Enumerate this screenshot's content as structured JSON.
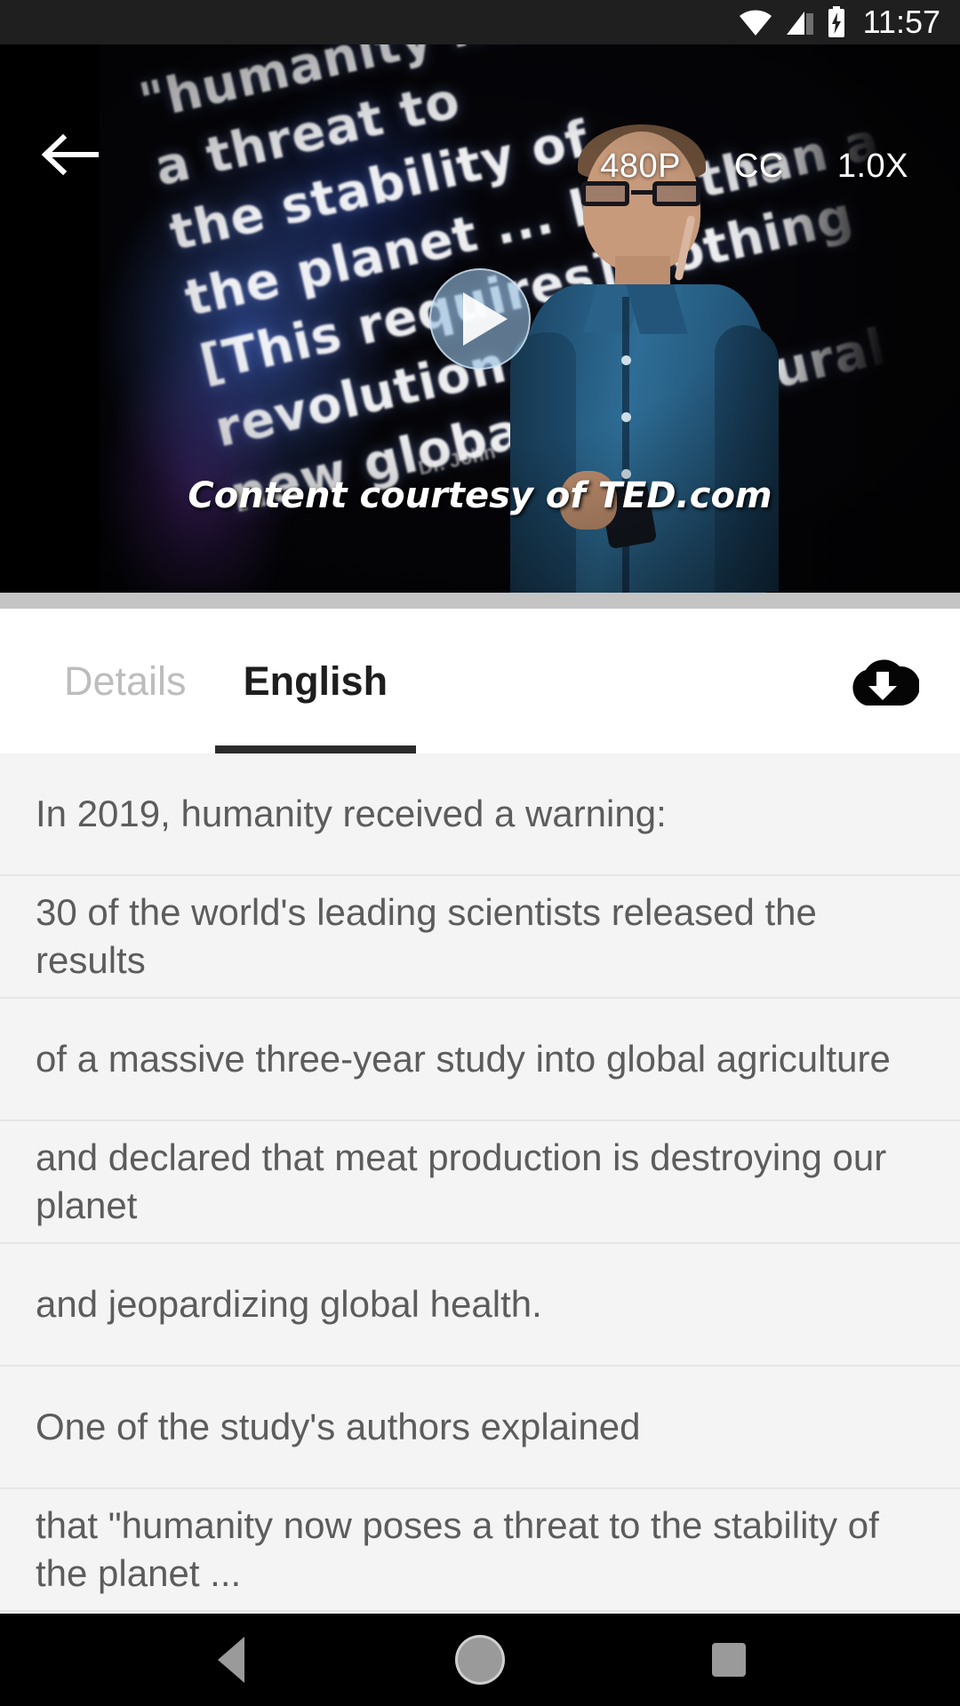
{
  "status_bar": {
    "time": "11:57",
    "icons": [
      "wifi-icon",
      "cellular-signal-icon",
      "battery-charging-icon"
    ]
  },
  "player": {
    "back_icon": "back-arrow-icon",
    "play_icon": "play-icon",
    "controls": [
      {
        "name": "quality",
        "label": "480P"
      },
      {
        "name": "captions",
        "label": "CC"
      },
      {
        "name": "speed",
        "label": "1.0X"
      }
    ],
    "slide_text": "\"humanity now poses\na threat to\nthe stability of\nthe planet ... less than a\n[This requires] nothing\nrevolution.\"\nnew global agricultural",
    "slide_byline": "Dr. John",
    "courtesy": "Content courtesy of TED.com"
  },
  "tabs": {
    "items": [
      {
        "label": "Details",
        "active": false
      },
      {
        "label": "English",
        "active": true
      }
    ],
    "download_icon": "cloud-download-icon"
  },
  "transcript": {
    "lines": [
      "In 2019, humanity received a warning:",
      "30 of the world's leading scientists released the results",
      "of a massive three-year study into global agriculture",
      "and declared that meat production is destroying our planet",
      "and jeopardizing global health.",
      "One of the study's authors explained",
      "that \"humanity now poses a threat to the stability of the planet ..."
    ]
  },
  "navbar": {
    "buttons": [
      {
        "name": "back",
        "icon": "triangle-back-icon"
      },
      {
        "name": "home",
        "icon": "circle-home-icon"
      },
      {
        "name": "recents",
        "icon": "square-recents-icon"
      }
    ]
  },
  "colors": {
    "status_bar_bg": "#1f1f1f",
    "tab_active": "#1e1e1e",
    "tab_inactive": "#bdbdbd",
    "transcript_bg": "#f4f4f4",
    "transcript_text": "#5c5c5c",
    "divider": "#c4c4c4",
    "navbar_bg": "#000000"
  }
}
